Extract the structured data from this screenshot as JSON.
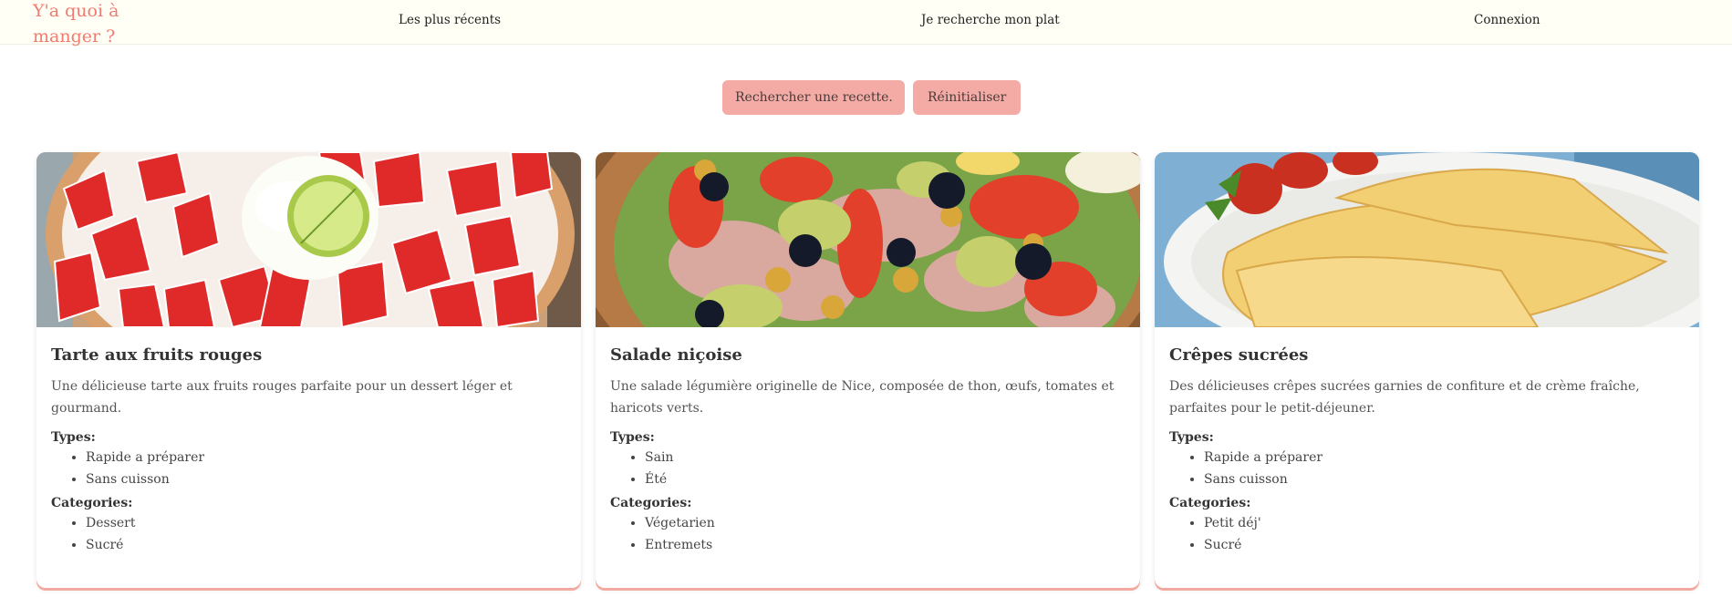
{
  "navbar": {
    "logo": "Y'a quoi à manger ?",
    "links": [
      "Les plus récents",
      "Je recherche mon plat",
      "Connexion"
    ]
  },
  "search": {
    "placeholder": "Rechercher une recette...",
    "reset_label": "Réinitialiser"
  },
  "labels": {
    "types": "Types:",
    "categories": "Categories:"
  },
  "recipes": [
    {
      "title": "Tarte aux fruits rouges",
      "description": "Une délicieuse tarte aux fruits rouges parfaite pour un dessert léger et gourmand.",
      "types": [
        "Rapide a préparer",
        "Sans cuisson"
      ],
      "categories": [
        "Dessert",
        "Sucré"
      ]
    },
    {
      "title": "Salade niçoise",
      "description": "Une salade légumière originelle de Nice, composée de thon, œufs, tomates et haricots verts.",
      "types": [
        "Sain",
        "Été"
      ],
      "categories": [
        "Végetarien",
        "Entremets"
      ]
    },
    {
      "title": "Crêpes sucrées",
      "description": "Des délicieuses crêpes sucrées garnies de confiture et de crème fraîche, parfaites pour le petit-déjeuner.",
      "types": [
        "Rapide a préparer",
        "Sans cuisson"
      ],
      "categories": [
        "Petit déj'",
        "Sucré"
      ]
    }
  ],
  "colors": {
    "accent": "#f07c71",
    "button_bg": "#f4aba5",
    "navbar_bg": "#fffff6"
  }
}
